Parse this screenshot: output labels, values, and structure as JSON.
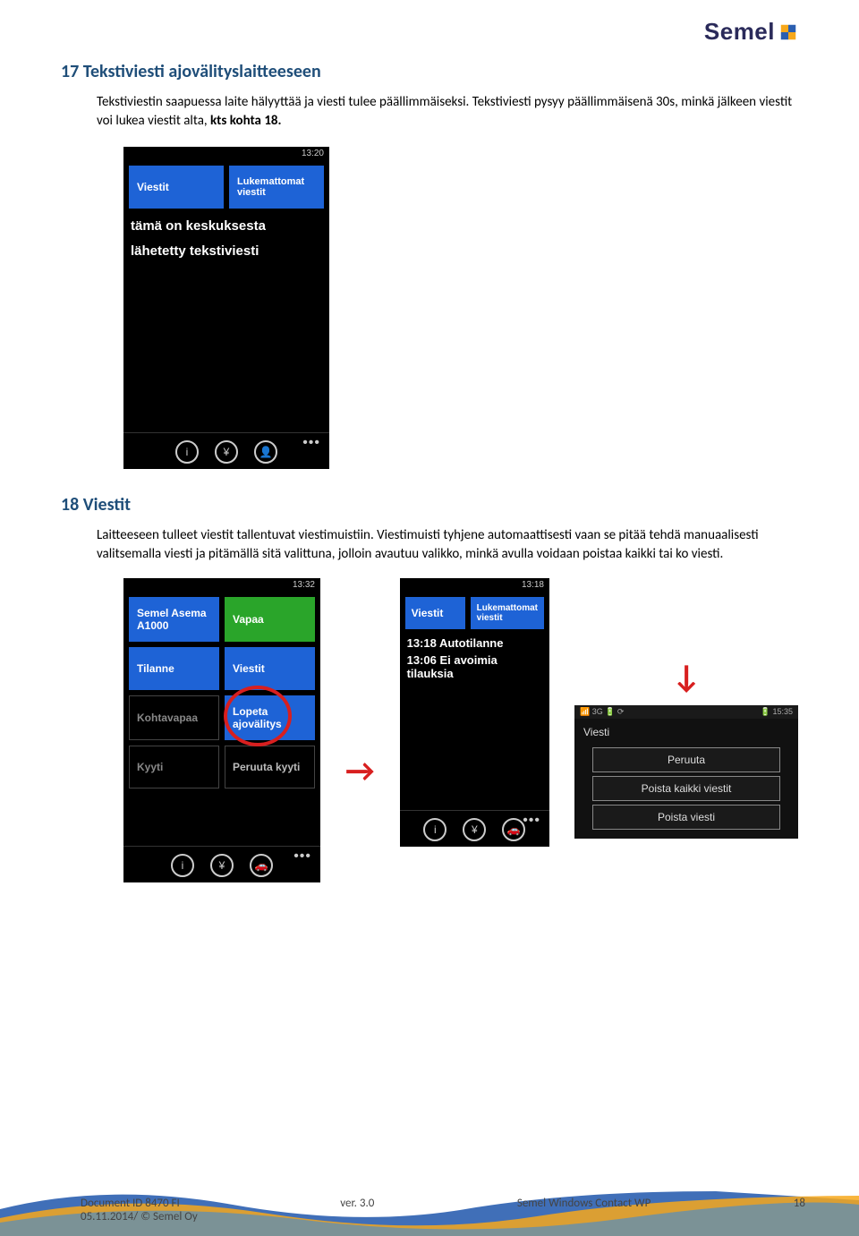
{
  "logo": {
    "text": "Semel"
  },
  "section17": {
    "title": "17 Tekstiviesti ajovälityslaitteeseen",
    "body_a": "Tekstiviestin saapuessa laite hälyyttää ja viesti tulee päällimmäiseksi. Tekstiviesti pysyy päällimmäisenä 30s, minkä jälkeen viestit voi lukea viestit alta, ",
    "body_b": "kts kohta 18."
  },
  "screenshot1": {
    "time": "13:20",
    "tabs": {
      "left": "Viestit",
      "right": "Lukemattomat viestit"
    },
    "message_line1": "tämä on keskuksesta",
    "message_line2": "lähetetty tekstiviesti",
    "icons": [
      "i",
      "¥",
      "👤"
    ]
  },
  "section18": {
    "title": "18 Viestit",
    "body": "Laitteeseen tulleet viestit tallentuvat viestimuistiin. Viestimuisti tyhjene automaattisesti vaan se pitää tehdä manuaalisesti valitsemalla viesti ja pitämällä sitä valittuna, jolloin avautuu  valikko, minkä avulla voidaan poistaa kaikki tai ko viesti."
  },
  "screenshot2": {
    "time": "13:32",
    "tiles": {
      "a1": "Semel Asema A1000",
      "a2": "Vapaa",
      "b1": "Tilanne",
      "b2": "Viestit",
      "c1": "Kohtavapaa",
      "c2": "Lopeta ajovälitys",
      "d1": "Kyyti",
      "d2": "Peruuta kyyti"
    },
    "icons": [
      "i",
      "¥",
      "🚗"
    ]
  },
  "screenshot3": {
    "time": "13:18",
    "tabs": {
      "left": "Viestit",
      "right": "Lukemattomat viestit"
    },
    "lines": [
      "13:18 Autotilanne",
      "13:06 Ei avoimia tilauksia"
    ],
    "icons": [
      "i",
      "¥",
      "🚗"
    ]
  },
  "screenshot4": {
    "status_left": "📶 3G 🔋 ⟳",
    "status_right": "🔋 15:35",
    "title": "Viesti",
    "buttons": [
      "Peruuta",
      "Poista kaikki viestit",
      "Poista viesti"
    ]
  },
  "footer": {
    "doc_id": "Document ID 8470 FI",
    "date_cr": "05.11.2014/ © Semel Oy",
    "version": "ver. 3.0",
    "product": "Semel Windows Contact WP",
    "page": "18"
  }
}
